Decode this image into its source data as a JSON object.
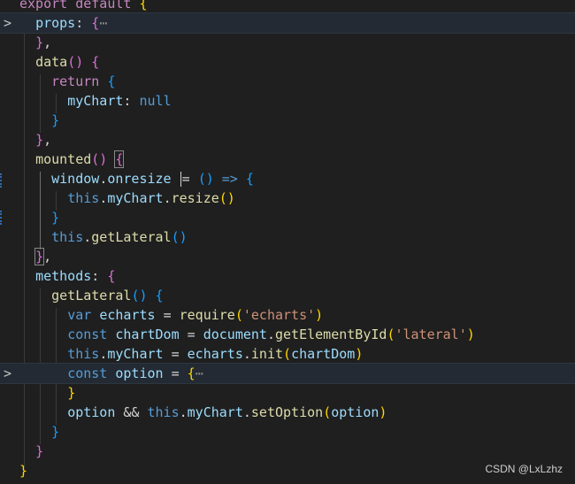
{
  "lines": {
    "l0": {
      "kw": "export default",
      "brace": "{"
    },
    "l1": {
      "prop": "props",
      "colon": ":",
      "open": "{",
      "ellipsis": "⋯"
    },
    "l2": {
      "close": "}",
      "comma": ","
    },
    "l3": {
      "fn": "data",
      "parens": "()",
      "open": "{"
    },
    "l4": {
      "kw": "return",
      "open": "{"
    },
    "l5": {
      "prop": "myChart",
      "colon": ":",
      "value": "null"
    },
    "l6": {
      "close": "}"
    },
    "l7": {
      "close": "}",
      "comma": ","
    },
    "l8": {
      "fn": "mounted",
      "parens": "()",
      "open": "{"
    },
    "l9": {
      "obj": "window",
      "dot": ".",
      "prop": "onresize",
      "eq": "=",
      "parens": "()",
      "arrow": "=>",
      "open": "{"
    },
    "l10": {
      "this": "this",
      "dot1": ".",
      "prop": "myChart",
      "dot2": ".",
      "fn": "resize",
      "parens": "()"
    },
    "l11": {
      "close": "}"
    },
    "l12": {
      "this": "this",
      "dot": ".",
      "fn": "getLateral",
      "parens": "()"
    },
    "l13": {
      "close": "}",
      "comma": ","
    },
    "l14": {
      "prop": "methods",
      "colon": ":",
      "open": "{"
    },
    "l15": {
      "fn": "getLateral",
      "parens": "()",
      "open": "{"
    },
    "l16": {
      "kw": "var",
      "name": "echarts",
      "eq": "=",
      "fn": "require",
      "open": "(",
      "str": "'echarts'",
      "close": ")"
    },
    "l17": {
      "kw": "const",
      "name": "chartDom",
      "eq": "=",
      "obj": "document",
      "dot": ".",
      "fn": "getElementById",
      "open": "(",
      "str": "'lateral'",
      "close": ")"
    },
    "l18": {
      "this": "this",
      "dot1": ".",
      "prop": "myChart",
      "eq": "=",
      "obj": "echarts",
      "dot2": ".",
      "fn": "init",
      "open": "(",
      "arg": "chartDom",
      "close": ")"
    },
    "l19": {
      "kw": "const",
      "name": "option",
      "eq": "=",
      "open": "{",
      "ellipsis": "⋯"
    },
    "l20": {
      "close": "}"
    },
    "l21": {
      "name": "option",
      "and": "&&",
      "this": "this",
      "dot1": ".",
      "prop": "myChart",
      "dot2": ".",
      "fn": "setOption",
      "open": "(",
      "arg": "option",
      "close": ")"
    },
    "l22": {
      "close": "}"
    },
    "l23": {
      "close": "}"
    },
    "l24": {
      "close": "}"
    }
  },
  "folds": {
    "collapsed": ">"
  },
  "watermark": "CSDN @LxLzhz",
  "colors": {
    "background": "#1f1f1f",
    "keyword": "#c586c0",
    "storage": "#569cd6",
    "function": "#dcdcaa",
    "string": "#ce9178",
    "variable": "#9cdcfe",
    "bracket_gold": "#ffd700",
    "bracket_orchid": "#da70d6",
    "bracket_blue": "#179fff"
  }
}
